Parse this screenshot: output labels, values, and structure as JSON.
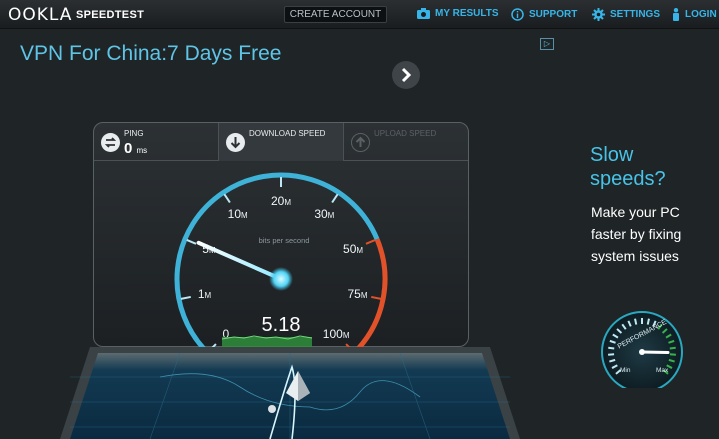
{
  "header": {
    "logo": "OOKLA",
    "product": "SPEEDTEST",
    "create_account": "CREATE ACCOUNT",
    "nav": [
      {
        "label": "MY RESULTS",
        "icon": "camera-icon"
      },
      {
        "label": "SUPPORT",
        "icon": "info-icon"
      },
      {
        "label": "SETTINGS",
        "icon": "gear-icon"
      },
      {
        "label": "LOGIN",
        "icon": "person-icon"
      }
    ]
  },
  "ad": {
    "headline": "VPN For China:7 Days Free",
    "choice_icon": "ad-choices-icon",
    "arrow_icon": "chevron-right-icon"
  },
  "promo": {
    "title_line1": "Slow",
    "title_line2": "speeds?",
    "body_line1": "Make your PC",
    "body_line2": "faster by fixing",
    "body_line3": "system issues",
    "widget_label": "PERFORMANCE",
    "widget_min": "Min",
    "widget_max": "Max",
    "widget_level": 0.85
  },
  "test": {
    "ping_label": "PING",
    "ping_value": "0",
    "ping_unit": "ms",
    "download_label": "DOWNLOAD SPEED",
    "upload_label": "UPLOAD SPEED",
    "speed_value": "5.18",
    "unit_caption": "bits per second",
    "gauge_ticks": [
      {
        "label": "0",
        "suffix": ""
      },
      {
        "label": "1",
        "suffix": "M"
      },
      {
        "label": "5",
        "suffix": "M"
      },
      {
        "label": "10",
        "suffix": "M"
      },
      {
        "label": "20",
        "suffix": "M"
      },
      {
        "label": "30",
        "suffix": "M"
      },
      {
        "label": "50",
        "suffix": "M"
      },
      {
        "label": "75",
        "suffix": "M"
      },
      {
        "label": "100",
        "suffix": "M"
      }
    ],
    "needle_value_mbps": 5.18
  },
  "colors": {
    "accent": "#37b5e8",
    "gauge_arc": "#3fb2d8",
    "gauge_high": "#e2522a",
    "needle_glow": "#7fe6ff",
    "graph": "#36b34a"
  }
}
